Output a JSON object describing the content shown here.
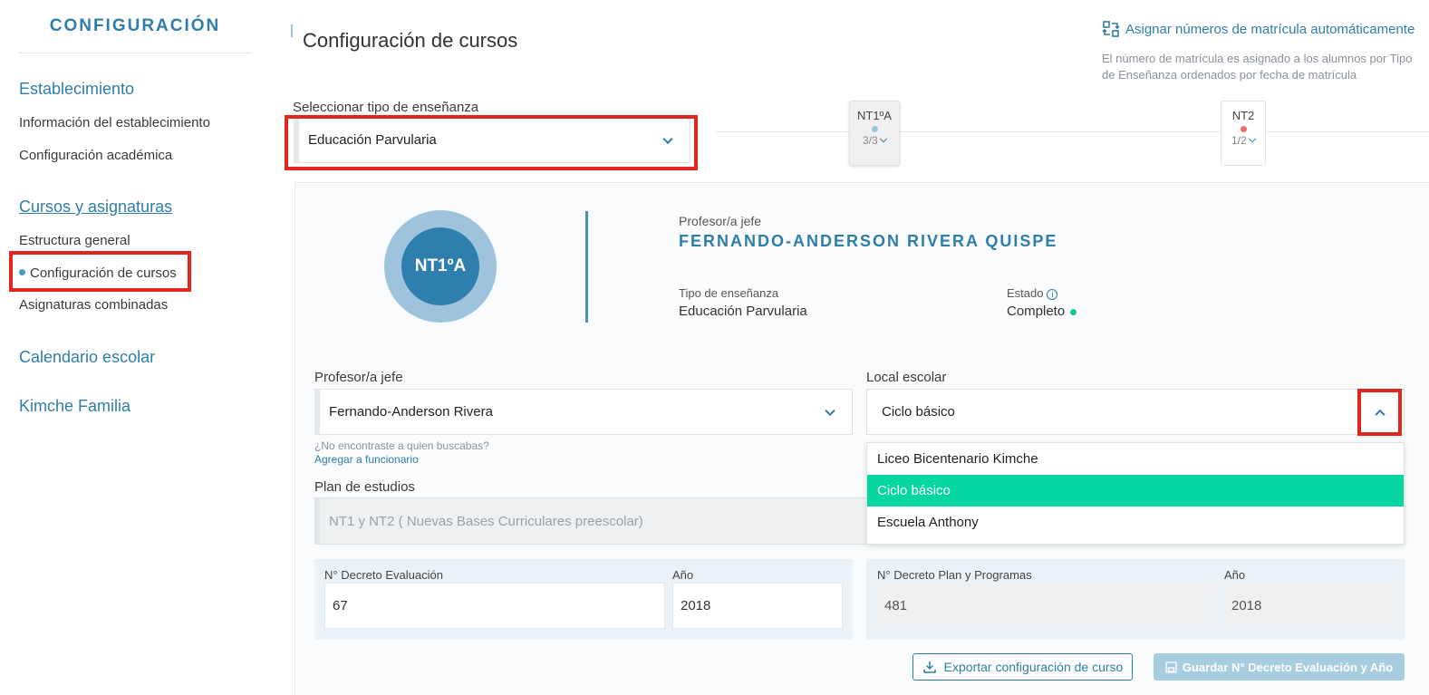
{
  "sidebar": {
    "title": "CONFIGURACIÓN",
    "sections": [
      {
        "label": "Establecimiento",
        "items": [
          "Información del establecimiento",
          "Configuración académica"
        ]
      },
      {
        "label": "Cursos y asignaturas",
        "items": [
          "Estructura general",
          "Configuración de cursos",
          "Asignaturas combinadas"
        ]
      },
      {
        "label": "Calendario escolar"
      },
      {
        "label": "Kimche Familia"
      }
    ]
  },
  "header": {
    "title": "Configuración de cursos",
    "auto_assign_link": "Asignar números de matrícula automáticamente",
    "auto_assign_desc": "El número de matrícula es asignado a los alumnos por Tipo de Enseñanza ordenados por fecha de matrícula"
  },
  "teaching_type": {
    "label": "Seleccionar tipo de enseñanza",
    "value": "Educación Parvularia"
  },
  "course_tabs": [
    {
      "name": "NT1ºA",
      "count": "3/3",
      "dot_color": "#9dc4dc"
    },
    {
      "name": "NT2",
      "count": "1/2",
      "dot_color": "#f26b6b"
    }
  ],
  "course": {
    "badge": "NT1ºA",
    "teacher_label": "Profesor/a jefe",
    "teacher_name": "FERNANDO-ANDERSON RIVERA QUISPE",
    "type_label": "Tipo de enseñanza",
    "type_value": "Educación Parvularia",
    "state_label": "Estado",
    "state_value": "Completo"
  },
  "form": {
    "teacher_label": "Profesor/a jefe",
    "teacher_value": "Fernando-Anderson Rivera",
    "not_found_hint": "¿No encontraste a quien buscabas?",
    "add_staff_link": "Agregar a funcionario",
    "local_label": "Local escolar",
    "local_value": "Ciclo básico",
    "local_options": [
      "Liceo Bicentenario Kimche",
      "Ciclo básico",
      "Escuela Anthony"
    ],
    "plan_label": "Plan de estudios",
    "plan_value": "NT1 y NT2 ( Nuevas Bases Curriculares preescolar)"
  },
  "decree_eval": {
    "label": "N° Decreto Evaluación",
    "value": "67",
    "year_label": "Año",
    "year_value": "2018"
  },
  "decree_plan": {
    "label": "N° Decreto Plan y Programas",
    "value": "481",
    "year_label": "Año",
    "year_value": "2018"
  },
  "buttons": {
    "export": "Exportar configuración de curso",
    "save": "Guardar N° Decreto Evaluación y Año"
  },
  "colors": {
    "accent": "#2e7ea8",
    "selected_option": "#06d6a0",
    "highlight_box": "#e0261e",
    "status_ok": "#12c89a"
  }
}
